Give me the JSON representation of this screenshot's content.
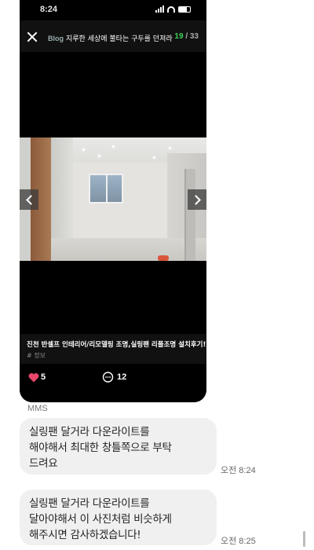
{
  "phone": {
    "status": {
      "time": "8:24"
    },
    "header": {
      "blog_tag": "Blog",
      "title": "지루한 세상에 불타는 구두를 던져라",
      "current": "19",
      "separator": "/",
      "total": "33"
    },
    "post": {
      "title": "진천 반셀프 인테리어/리모델링 조명,실링팬 리플조명 설치후기!",
      "tag": "# 정보"
    },
    "actions": {
      "likes": "5",
      "comments": "12"
    },
    "colors": {
      "counter_accent": "#3fd05a",
      "heart": "#e8476b"
    }
  },
  "chat": {
    "sender": "MMS",
    "messages": [
      {
        "lines": [
          "실링팬 달거라 다운라이트를",
          "해야해서 최대한 창틀쪽으로 부탁",
          "드려요"
        ],
        "time": "오전 8:24"
      },
      {
        "lines": [
          "실링팬 달거라 다운라이트를",
          "달아야해서 이 사진처럼 비슷하게",
          "해주시면 감사하겠습니다!"
        ],
        "time": "오전 8:25"
      }
    ]
  }
}
